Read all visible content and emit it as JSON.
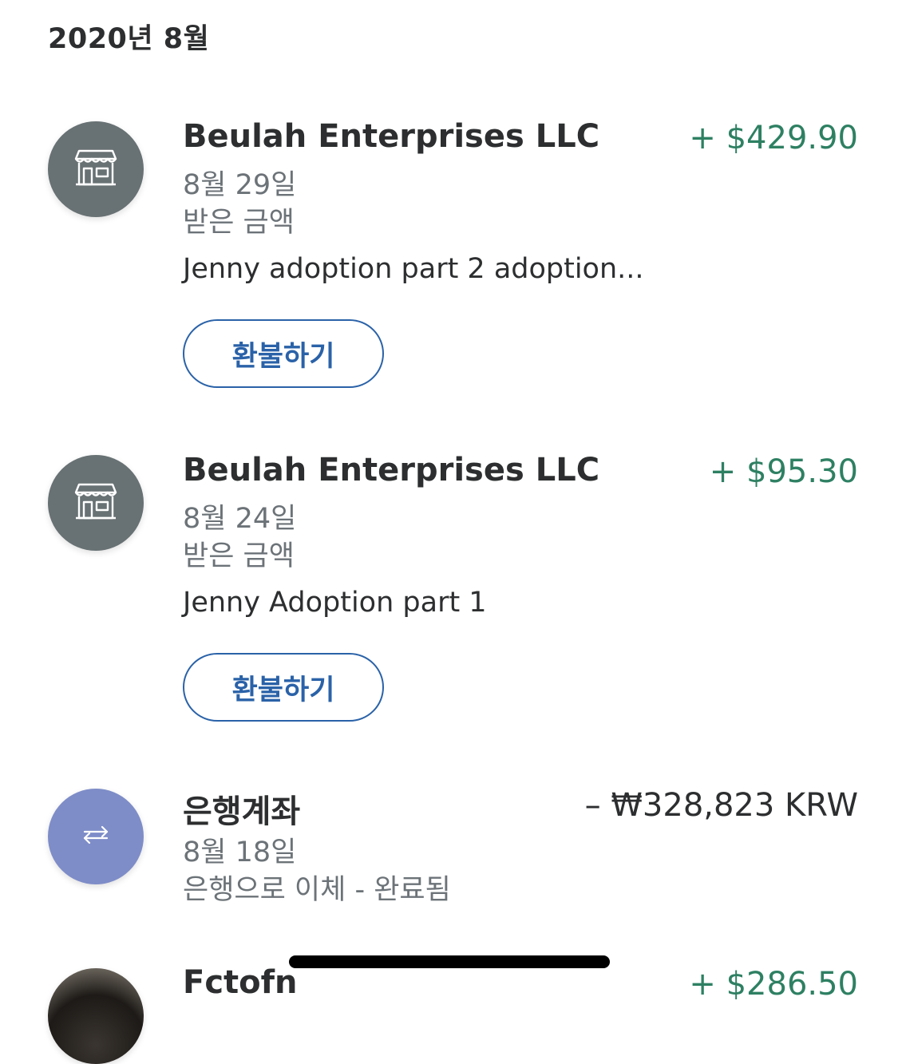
{
  "month_header": "2020년 8월",
  "colors": {
    "credit": "#2e8063",
    "button": "#2a62a8",
    "merchant_avatar": "#687173",
    "transfer_avatar": "#7e8dc8"
  },
  "transactions": [
    {
      "name": "Beulah Enterprises LLC",
      "amount": "+ $429.90",
      "date": "8월 29일",
      "type": "받은 금액",
      "note": "Jenny adoption part 2 adoption...",
      "button": "환불하기",
      "icon": "storefront-icon"
    },
    {
      "name": "Beulah Enterprises LLC",
      "amount": "+ $95.30",
      "date": "8월 24일",
      "type": "받은 금액",
      "note": "Jenny Adoption part 1",
      "button": "환불하기",
      "icon": "storefront-icon"
    },
    {
      "name": "은행계좌",
      "amount": "– ₩328,823 KRW",
      "date": "8월 18일",
      "type": "은행으로 이체 - 완료됨",
      "icon": "transfer-arrows-icon"
    },
    {
      "name": "Fctofn",
      "amount": "+ $286.50",
      "icon": "profile-photo"
    }
  ]
}
